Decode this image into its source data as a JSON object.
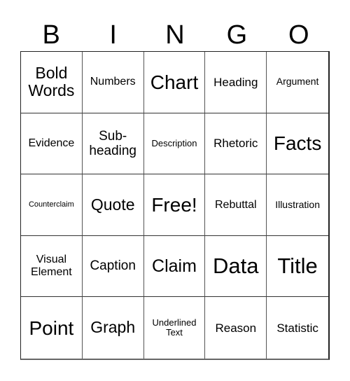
{
  "header": [
    "B",
    "I",
    "N",
    "G",
    "O"
  ],
  "cells": [
    {
      "label": "Bold Words",
      "size": "s23"
    },
    {
      "label": "Numbers",
      "size": "s16"
    },
    {
      "label": "Chart",
      "size": "s28"
    },
    {
      "label": "Heading",
      "size": "s17"
    },
    {
      "label": "Argument",
      "size": "s14"
    },
    {
      "label": "Evidence",
      "size": "s16"
    },
    {
      "label": "Sub-heading",
      "size": "s19"
    },
    {
      "label": "Description",
      "size": "s13"
    },
    {
      "label": "Rhetoric",
      "size": "s17"
    },
    {
      "label": "Facts",
      "size": "s28"
    },
    {
      "label": "Counterclaim",
      "size": "s11"
    },
    {
      "label": "Quote",
      "size": "s23"
    },
    {
      "label": "Free!",
      "size": "s28"
    },
    {
      "label": "Rebuttal",
      "size": "s16"
    },
    {
      "label": "Illustration",
      "size": "s14"
    },
    {
      "label": "Visual Element",
      "size": "s16"
    },
    {
      "label": "Caption",
      "size": "s19"
    },
    {
      "label": "Claim",
      "size": "s25"
    },
    {
      "label": "Data",
      "size": "s31"
    },
    {
      "label": "Title",
      "size": "s31"
    },
    {
      "label": "Point",
      "size": "s28"
    },
    {
      "label": "Graph",
      "size": "s23"
    },
    {
      "label": "Underlined Text",
      "size": "s13"
    },
    {
      "label": "Reason",
      "size": "s17"
    },
    {
      "label": "Statistic",
      "size": "s17"
    }
  ]
}
